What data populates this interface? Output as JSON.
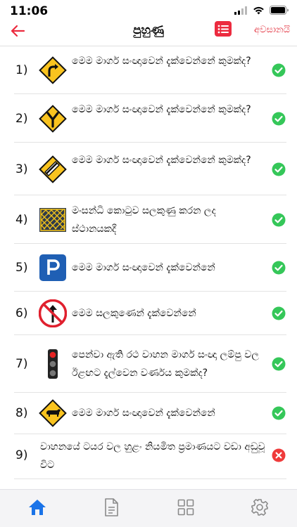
{
  "status_bar": {
    "time": "11:06",
    "signal_icon": "cellular-signal-icon",
    "wifi_icon": "wifi-icon",
    "battery_icon": "battery-icon"
  },
  "nav": {
    "title": "පුහුණු",
    "end_label": "අවසානයි",
    "back_icon": "back-arrow-icon",
    "list_icon": "list-icon"
  },
  "colors": {
    "accent": "#ec2b3f",
    "correct": "#35c759",
    "wrong": "#ef3b3b",
    "tab_active": "#1a73e8",
    "tab_inactive": "#8a8a8a"
  },
  "questions": [
    {
      "number": "1)",
      "text": "මෙම මාර්ග සංඥාවෙන් දැක්වෙන්නේ කුමක්ද?",
      "sign": "curve-right-warning-sign",
      "status": "correct"
    },
    {
      "number": "2)",
      "text": "මෙම මාර්ග සංඥාවෙන් දැක්වෙන්නේ කුමක්ද?",
      "sign": "y-junction-warning-sign",
      "status": "correct"
    },
    {
      "number": "3)",
      "text": "මෙම මාර්ග සංඥාවෙන් දැක්වෙන්නේ කුමක්ද?",
      "sign": "major-road-ahead-sign",
      "status": "correct"
    },
    {
      "number": "4)",
      "text": "මංසන්ධි කොටුව සලකුණු කරන ලද ස්ථානයකදී",
      "sign": "yellow-box-junction-sign",
      "status": "correct"
    },
    {
      "number": "5)",
      "text": "මෙම මාර්ග සංඥාවෙන් දැක්වෙන්නේ",
      "sign": "parking-sign",
      "status": "correct"
    },
    {
      "number": "6)",
      "text": "මෙම සලකුණෙන් දැක්වෙන්නේ",
      "sign": "no-straight-ahead-sign",
      "status": "correct"
    },
    {
      "number": "7)",
      "text": "පෙන්වා ඇති රථ වාහන මාර්ග සංඥා ලම්පු වල ඊළඟට දැල්වෙන වර්ණය කුමක්ද?",
      "sign": "traffic-light-sign",
      "status": "correct"
    },
    {
      "number": "8)",
      "text": "මෙම මාර්ග සංඥාවෙන් දැක්වෙන්නේ",
      "sign": "cattle-crossing-warning-sign",
      "status": "correct"
    },
    {
      "number": "9)",
      "text": "වාහනයේ ටයර වල හුළං නියමිත ප්‍රමාණයට වඩා අඩුවූ විට",
      "sign": "",
      "status": "wrong"
    }
  ],
  "tabs": [
    {
      "icon": "home-icon",
      "active": true
    },
    {
      "icon": "document-icon",
      "active": false
    },
    {
      "icon": "grid-icon",
      "active": false
    },
    {
      "icon": "settings-gear-icon",
      "active": false
    }
  ]
}
